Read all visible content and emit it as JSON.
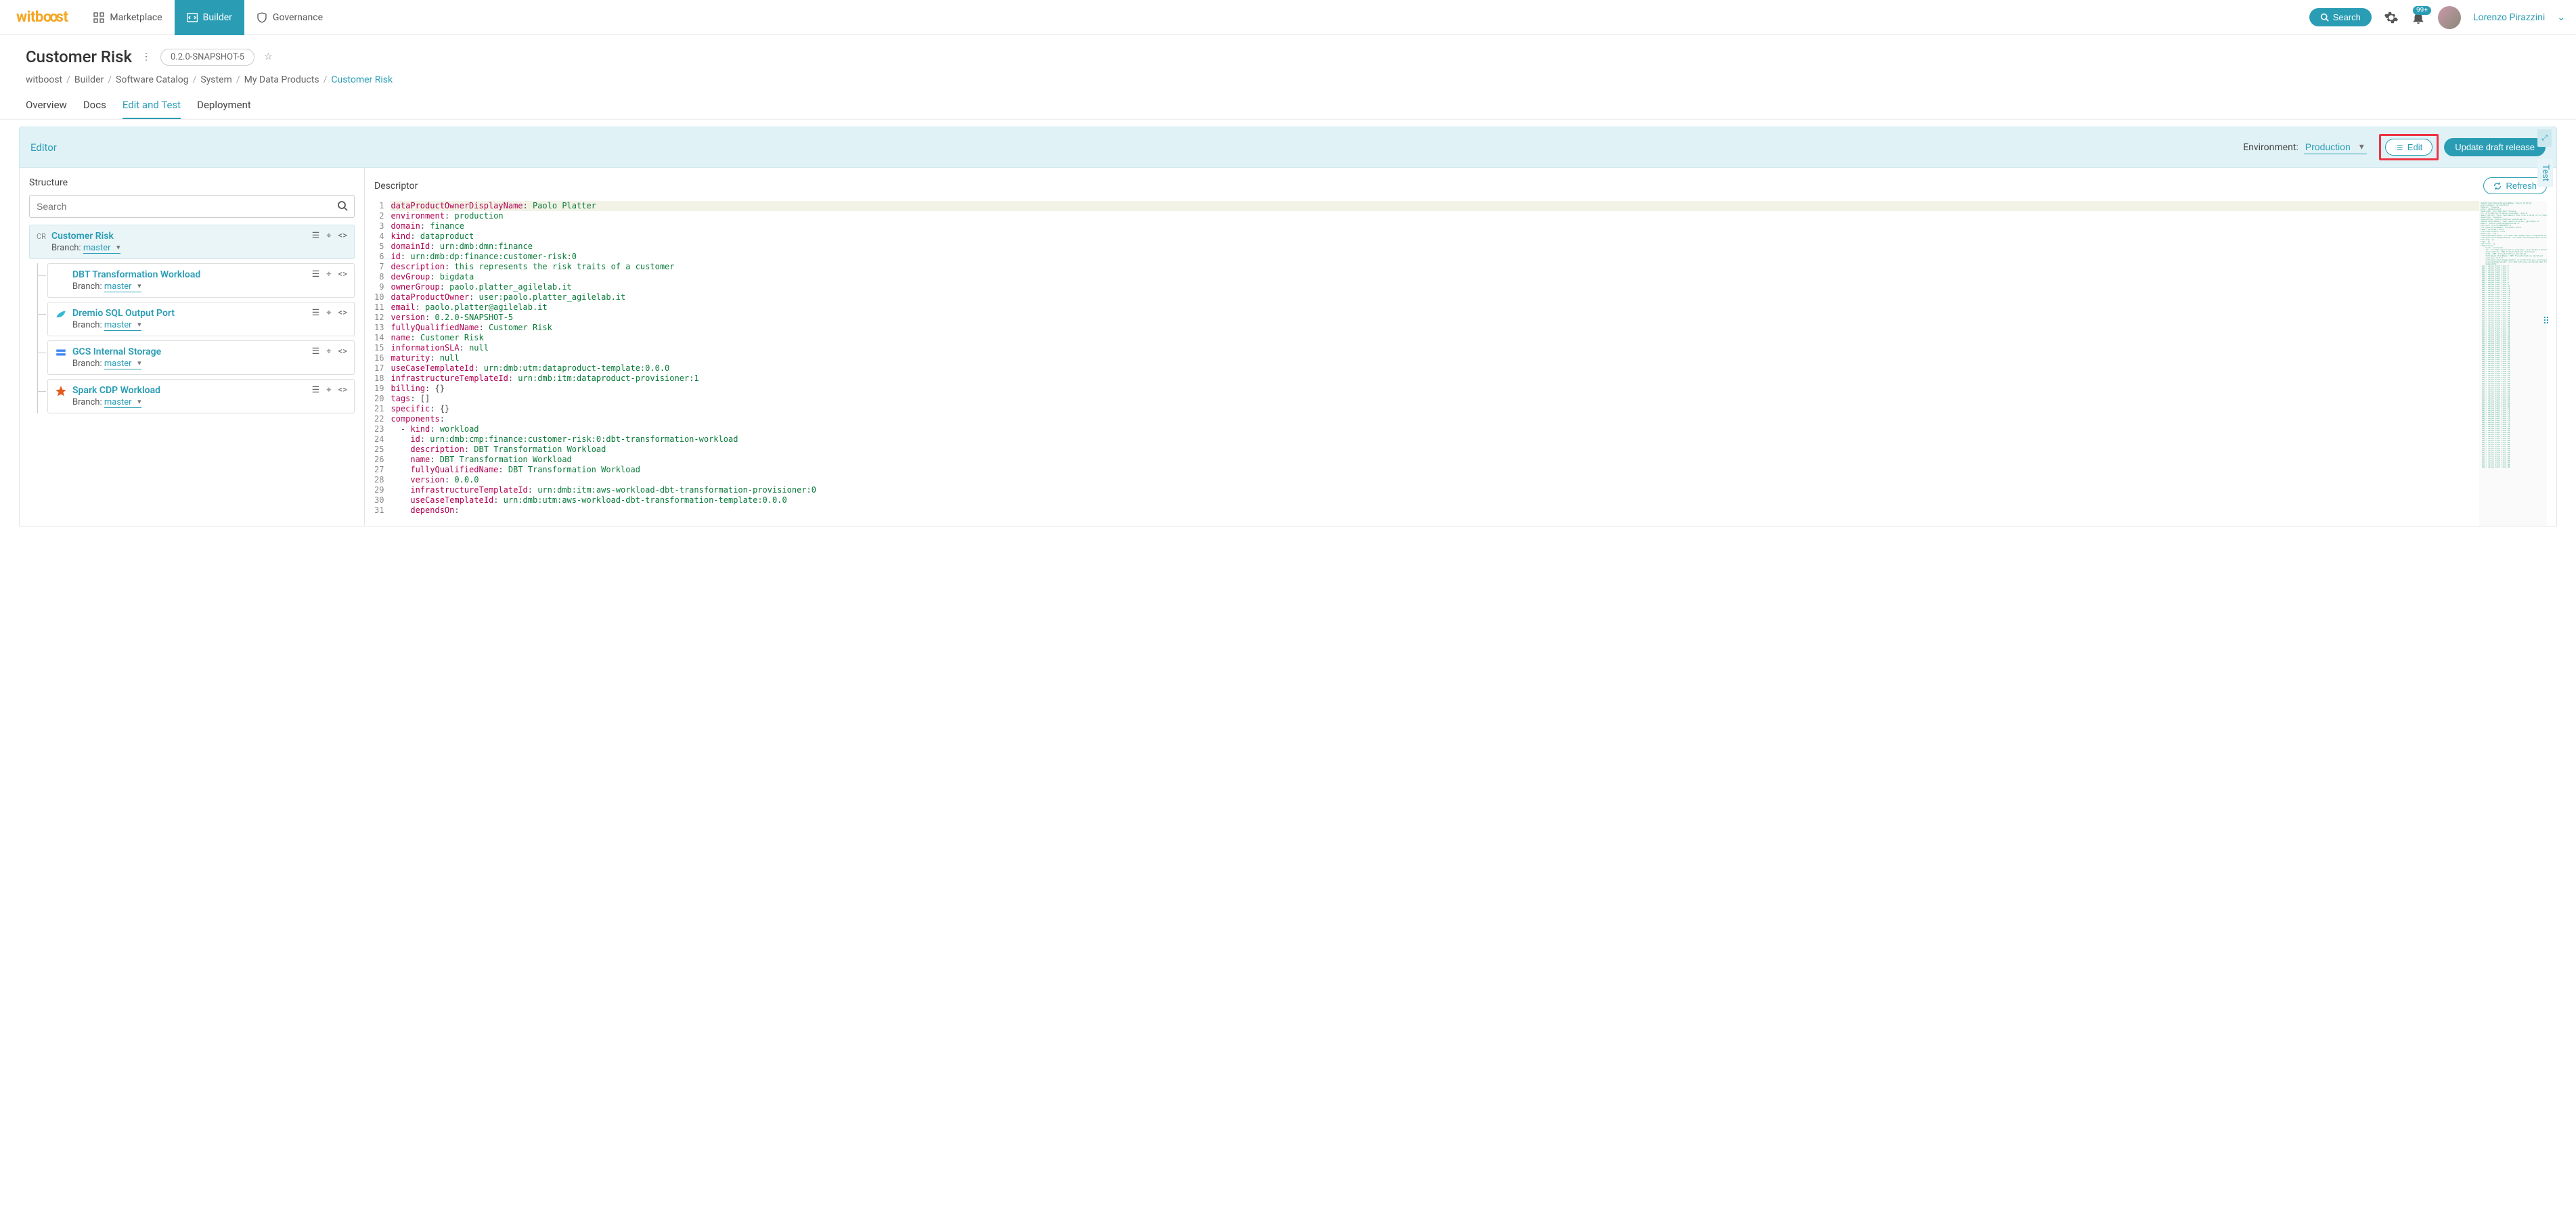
{
  "brand": "witboost",
  "nav": {
    "marketplace": "Marketplace",
    "builder": "Builder",
    "governance": "Governance"
  },
  "search_label": "Search",
  "notification_badge": "99+",
  "user": {
    "name": "Lorenzo Pirazzini"
  },
  "page": {
    "title": "Customer Risk",
    "version": "0.2.0-SNAPSHOT-5"
  },
  "breadcrumb": [
    "witboost",
    "Builder",
    "Software Catalog",
    "System",
    "My Data Products",
    "Customer Risk"
  ],
  "tabs": [
    "Overview",
    "Docs",
    "Edit and Test",
    "Deployment"
  ],
  "active_tab": "Edit and Test",
  "editor": {
    "label": "Editor",
    "env_label": "Environment:",
    "env_value": "Production",
    "edit_btn": "Edit",
    "update_btn": "Update draft release",
    "test_side": "Test"
  },
  "structure": {
    "title": "Structure",
    "search_placeholder": "Search",
    "root": {
      "badge": "CR",
      "name": "Customer Risk",
      "branch_label": "Branch:",
      "branch": "master"
    },
    "children": [
      {
        "name": "DBT Transformation Workload",
        "branch_label": "Branch:",
        "branch": "master",
        "icon": "dbt"
      },
      {
        "name": "Dremio SQL Output Port",
        "branch_label": "Branch:",
        "branch": "master",
        "icon": "dremio"
      },
      {
        "name": "GCS Internal Storage",
        "branch_label": "Branch:",
        "branch": "master",
        "icon": "gcs"
      },
      {
        "name": "Spark CDP Workload",
        "branch_label": "Branch:",
        "branch": "master",
        "icon": "spark"
      }
    ]
  },
  "descriptor": {
    "title": "Descriptor",
    "refresh_btn": "Refresh",
    "lines": [
      [
        [
          "k",
          "dataProductOwnerDisplayName"
        ],
        [
          "p",
          ": "
        ],
        [
          "s",
          "Paolo Platter"
        ]
      ],
      [
        [
          "k",
          "environment"
        ],
        [
          "p",
          ": "
        ],
        [
          "s",
          "production"
        ]
      ],
      [
        [
          "k",
          "domain"
        ],
        [
          "p",
          ": "
        ],
        [
          "s",
          "finance"
        ]
      ],
      [
        [
          "k",
          "kind"
        ],
        [
          "p",
          ": "
        ],
        [
          "s",
          "dataproduct"
        ]
      ],
      [
        [
          "k",
          "domainId"
        ],
        [
          "p",
          ": "
        ],
        [
          "s",
          "urn:dmb:dmn:finance"
        ]
      ],
      [
        [
          "k",
          "id"
        ],
        [
          "p",
          ": "
        ],
        [
          "s",
          "urn:dmb:dp:finance:customer-risk:0"
        ]
      ],
      [
        [
          "k",
          "description"
        ],
        [
          "p",
          ": "
        ],
        [
          "s",
          "this represents the risk traits of a customer"
        ]
      ],
      [
        [
          "k",
          "devGroup"
        ],
        [
          "p",
          ": "
        ],
        [
          "s",
          "bigdata"
        ]
      ],
      [
        [
          "k",
          "ownerGroup"
        ],
        [
          "p",
          ": "
        ],
        [
          "s",
          "paolo.platter_agilelab.it"
        ]
      ],
      [
        [
          "k",
          "dataProductOwner"
        ],
        [
          "p",
          ": "
        ],
        [
          "s",
          "user:paolo.platter_agilelab.it"
        ]
      ],
      [
        [
          "k",
          "email"
        ],
        [
          "p",
          ": "
        ],
        [
          "s",
          "paolo.platter@agilelab.it"
        ]
      ],
      [
        [
          "k",
          "version"
        ],
        [
          "p",
          ": "
        ],
        [
          "s",
          "0.2.0-SNAPSHOT-5"
        ]
      ],
      [
        [
          "k",
          "fullyQualifiedName"
        ],
        [
          "p",
          ": "
        ],
        [
          "s",
          "Customer Risk"
        ]
      ],
      [
        [
          "k",
          "name"
        ],
        [
          "p",
          ": "
        ],
        [
          "s",
          "Customer Risk"
        ]
      ],
      [
        [
          "k",
          "informationSLA"
        ],
        [
          "p",
          ": "
        ],
        [
          "n",
          "null"
        ]
      ],
      [
        [
          "k",
          "maturity"
        ],
        [
          "p",
          ": "
        ],
        [
          "n",
          "null"
        ]
      ],
      [
        [
          "k",
          "useCaseTemplateId"
        ],
        [
          "p",
          ": "
        ],
        [
          "s",
          "urn:dmb:utm:dataproduct-template:0.0.0"
        ]
      ],
      [
        [
          "k",
          "infrastructureTemplateId"
        ],
        [
          "p",
          ": "
        ],
        [
          "s",
          "urn:dmb:itm:dataproduct-provisioner:1"
        ]
      ],
      [
        [
          "k",
          "billing"
        ],
        [
          "p",
          ": {}"
        ]
      ],
      [
        [
          "k",
          "tags"
        ],
        [
          "p",
          ": []"
        ]
      ],
      [
        [
          "k",
          "specific"
        ],
        [
          "p",
          ": {}"
        ]
      ],
      [
        [
          "k",
          "components"
        ],
        [
          "p",
          ":"
        ]
      ],
      [
        [
          "p",
          "  - "
        ],
        [
          "k",
          "kind"
        ],
        [
          "p",
          ": "
        ],
        [
          "s",
          "workload"
        ]
      ],
      [
        [
          "p",
          "    "
        ],
        [
          "k",
          "id"
        ],
        [
          "p",
          ": "
        ],
        [
          "s",
          "urn:dmb:cmp:finance:customer-risk:0:dbt-transformation-workload"
        ]
      ],
      [
        [
          "p",
          "    "
        ],
        [
          "k",
          "description"
        ],
        [
          "p",
          ": "
        ],
        [
          "s",
          "DBT Transformation Workload"
        ]
      ],
      [
        [
          "p",
          "    "
        ],
        [
          "k",
          "name"
        ],
        [
          "p",
          ": "
        ],
        [
          "s",
          "DBT Transformation Workload"
        ]
      ],
      [
        [
          "p",
          "    "
        ],
        [
          "k",
          "fullyQualifiedName"
        ],
        [
          "p",
          ": "
        ],
        [
          "s",
          "DBT Transformation Workload"
        ]
      ],
      [
        [
          "p",
          "    "
        ],
        [
          "k",
          "version"
        ],
        [
          "p",
          ": "
        ],
        [
          "s",
          "0.0.0"
        ]
      ],
      [
        [
          "p",
          "    "
        ],
        [
          "k",
          "infrastructureTemplateId"
        ],
        [
          "p",
          ": "
        ],
        [
          "s",
          "urn:dmb:itm:aws-workload-dbt-transformation-provisioner:0"
        ]
      ],
      [
        [
          "p",
          "    "
        ],
        [
          "k",
          "useCaseTemplateId"
        ],
        [
          "p",
          ": "
        ],
        [
          "s",
          "urn:dmb:utm:aws-workload-dbt-transformation-template:0.0.0"
        ]
      ],
      [
        [
          "p",
          "    "
        ],
        [
          "k",
          "dependsOn"
        ],
        [
          "p",
          ":"
        ]
      ]
    ]
  }
}
